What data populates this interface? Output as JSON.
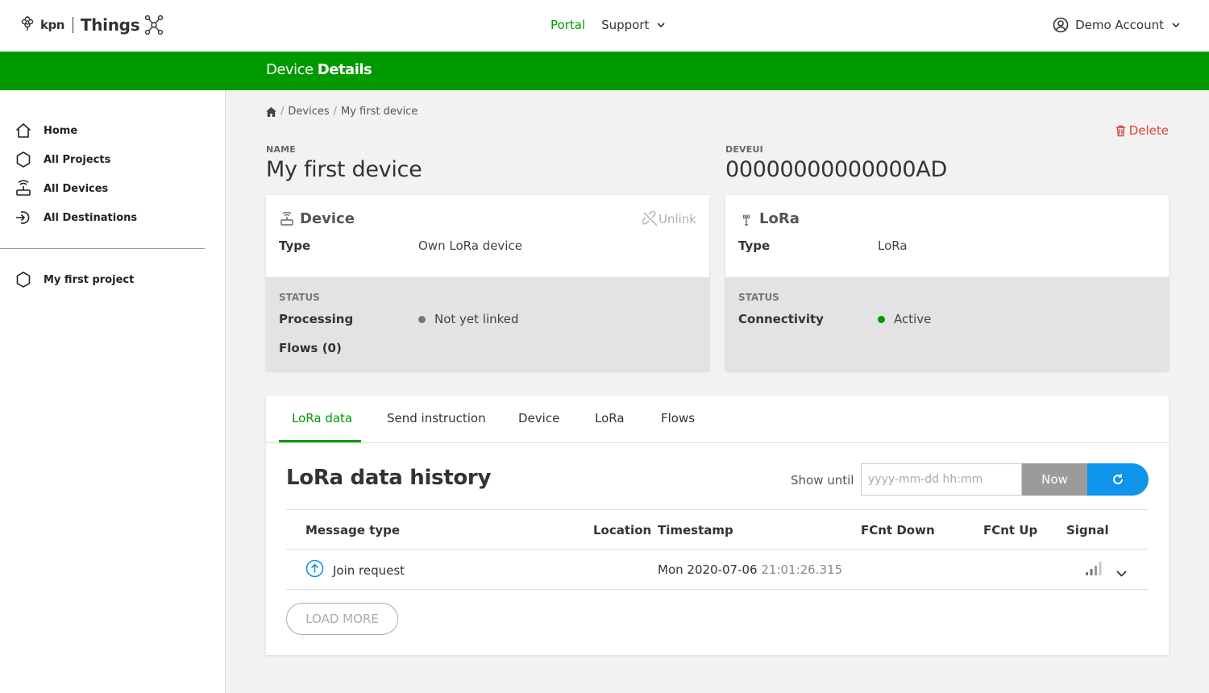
{
  "header": {
    "brand": "kpn",
    "product": "Things",
    "nav": {
      "portal": "Portal",
      "support": "Support"
    },
    "account": "Demo Account"
  },
  "page_title": {
    "prefix": "Device",
    "bold": "Details"
  },
  "sidebar": {
    "items": [
      {
        "label": "Home",
        "icon": "home-icon"
      },
      {
        "label": "All Projects",
        "icon": "hexagon-icon"
      },
      {
        "label": "All Devices",
        "icon": "router-icon"
      },
      {
        "label": "All Destinations",
        "icon": "destination-icon"
      }
    ],
    "projects": [
      {
        "label": "My first project",
        "icon": "hexagon-icon"
      }
    ]
  },
  "breadcrumb": {
    "sep": "/",
    "devices": "Devices",
    "current": "My first device"
  },
  "actions": {
    "delete": "Delete"
  },
  "device": {
    "name_label": "NAME",
    "name": "My first device",
    "deveui_label": "DEVEUI",
    "deveui": "00000000000000AD"
  },
  "device_card": {
    "title": "Device",
    "unlink": "Unlink",
    "type_label": "Type",
    "type_value": "Own LoRa device",
    "status_label": "STATUS",
    "processing_label": "Processing",
    "processing_value": "Not yet linked",
    "flows_label": "Flows (0)",
    "status_color": "#777777"
  },
  "lora_card": {
    "title": "LoRa",
    "type_label": "Type",
    "type_value": "LoRa",
    "status_label": "STATUS",
    "connectivity_label": "Connectivity",
    "connectivity_value": "Active",
    "status_color": "#009900"
  },
  "tabs": [
    "LoRa data",
    "Send instruction",
    "Device",
    "LoRa",
    "Flows"
  ],
  "history": {
    "title": "LoRa data history",
    "show_until": "Show until",
    "date_placeholder": "yyyy-mm-dd hh:mm",
    "now": "Now",
    "columns": [
      "Message type",
      "Location",
      "Timestamp",
      "FCnt Down",
      "FCnt Up",
      "Signal"
    ],
    "rows": [
      {
        "message_type": "Join request",
        "location": "",
        "date": "Mon 2020-07-06",
        "time": "21:01:26.315",
        "fcnt_down": "",
        "fcnt_up": ""
      }
    ],
    "load_more": "LOAD MORE"
  },
  "colors": {
    "brand_green": "#009900",
    "accent_blue": "#0f94ec",
    "danger": "#e0413a"
  }
}
